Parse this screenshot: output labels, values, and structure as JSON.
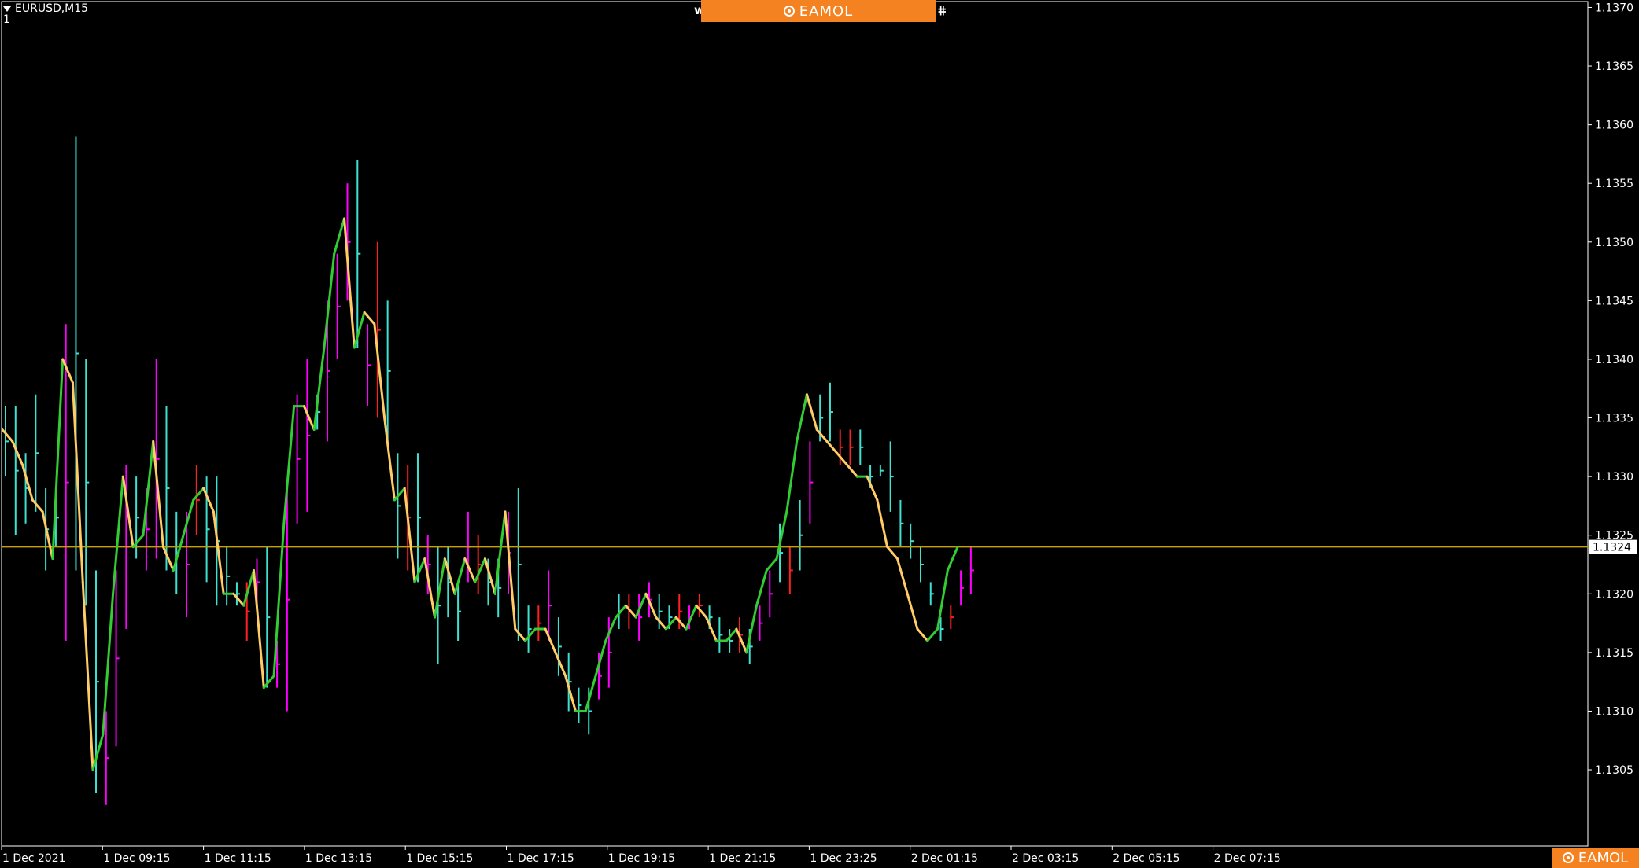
{
  "symbol_label": "EURUSD,M15",
  "subwindow_label": "1",
  "brand": "EAMOL",
  "current_price_label": "1.1324",
  "colors": {
    "background": "#000000",
    "frame": "#ffffff",
    "bar_up": "#40e0d0",
    "bar_down": "#ff00ff",
    "bar_red": "#ff2020",
    "line_up": "#33cc33",
    "line_down": "#ffcc66",
    "price_line": "#c8a000",
    "brand": "#f58220"
  },
  "chart_data": {
    "type": "line",
    "title": "",
    "xlabel": "",
    "ylabel": "",
    "ylim": [
      1.12985,
      1.13705
    ],
    "y_ticks": [
      "1.1305",
      "1.1310",
      "1.1315",
      "1.1320",
      "1.1325",
      "1.1330",
      "1.1335",
      "1.1340",
      "1.1345",
      "1.1350",
      "1.1355",
      "1.1360",
      "1.1365",
      "1.1370"
    ],
    "x_tick_labels": [
      "1 Dec 2021",
      "1 Dec 09:15",
      "1 Dec 11:15",
      "1 Dec 13:15",
      "1 Dec 15:15",
      "1 Dec 17:15",
      "1 Dec 19:15",
      "1 Dec 21:15",
      "1 Dec 23:25",
      "2 Dec 01:15",
      "2 Dec 03:15",
      "2 Dec 05:15",
      "2 Dec 07:15"
    ],
    "current_price": 1.1324,
    "line_values": [
      1.1334,
      1.1333,
      1.1331,
      1.1328,
      1.1327,
      1.1323,
      1.134,
      1.1338,
      1.1321,
      1.1305,
      1.1308,
      1.132,
      1.133,
      1.1324,
      1.1325,
      1.1333,
      1.1324,
      1.1322,
      1.1325,
      1.1328,
      1.1329,
      1.1327,
      1.132,
      1.132,
      1.1319,
      1.1322,
      1.1312,
      1.1313,
      1.1326,
      1.1336,
      1.1336,
      1.1334,
      1.1341,
      1.1349,
      1.1352,
      1.1341,
      1.1344,
      1.1343,
      1.1335,
      1.1328,
      1.1329,
      1.1321,
      1.1323,
      1.1318,
      1.1323,
      1.132,
      1.1323,
      1.1321,
      1.1323,
      1.132,
      1.1327,
      1.1317,
      1.1316,
      1.1317,
      1.1317,
      1.1315,
      1.1313,
      1.131,
      1.131,
      1.1313,
      1.1316,
      1.1318,
      1.1319,
      1.1318,
      1.132,
      1.1318,
      1.1317,
      1.1318,
      1.1317,
      1.1319,
      1.1318,
      1.1316,
      1.1316,
      1.1317,
      1.1315,
      1.1319,
      1.1322,
      1.1323,
      1.1327,
      1.1333,
      1.1337,
      1.1334,
      1.1333,
      1.1332,
      1.1331,
      1.133,
      1.133,
      1.1328,
      1.1324,
      1.1323,
      1.132,
      1.1317,
      1.1316,
      1.1317,
      1.1322,
      1.1324
    ],
    "bars": [
      {
        "h": 1.1336,
        "l": 1.133,
        "c": "u"
      },
      {
        "h": 1.1336,
        "l": 1.1325,
        "c": "u"
      },
      {
        "h": 1.1332,
        "l": 1.1326,
        "c": "u"
      },
      {
        "h": 1.1337,
        "l": 1.1327,
        "c": "u"
      },
      {
        "h": 1.1329,
        "l": 1.1322,
        "c": "u"
      },
      {
        "h": 1.1329,
        "l": 1.1324,
        "c": "u"
      },
      {
        "h": 1.1343,
        "l": 1.1316,
        "c": "d"
      },
      {
        "h": 1.1359,
        "l": 1.1322,
        "c": "u"
      },
      {
        "h": 1.134,
        "l": 1.1319,
        "c": "u"
      },
      {
        "h": 1.1322,
        "l": 1.1303,
        "c": "u"
      },
      {
        "h": 1.131,
        "l": 1.1302,
        "c": "d"
      },
      {
        "h": 1.1322,
        "l": 1.1307,
        "c": "d"
      },
      {
        "h": 1.1331,
        "l": 1.1317,
        "c": "d"
      },
      {
        "h": 1.133,
        "l": 1.1323,
        "c": "u"
      },
      {
        "h": 1.1329,
        "l": 1.1322,
        "c": "d"
      },
      {
        "h": 1.134,
        "l": 1.1323,
        "c": "d"
      },
      {
        "h": 1.1336,
        "l": 1.1322,
        "c": "u"
      },
      {
        "h": 1.1327,
        "l": 1.132,
        "c": "u"
      },
      {
        "h": 1.1327,
        "l": 1.1318,
        "c": "d"
      },
      {
        "h": 1.1331,
        "l": 1.1325,
        "c": "r"
      },
      {
        "h": 1.133,
        "l": 1.1321,
        "c": "u"
      },
      {
        "h": 1.133,
        "l": 1.1319,
        "c": "u"
      },
      {
        "h": 1.1324,
        "l": 1.1319,
        "c": "u"
      },
      {
        "h": 1.1321,
        "l": 1.1319,
        "c": "u"
      },
      {
        "h": 1.1321,
        "l": 1.1316,
        "c": "r"
      },
      {
        "h": 1.1323,
        "l": 1.1319,
        "c": "d"
      },
      {
        "h": 1.1324,
        "l": 1.1312,
        "c": "u"
      },
      {
        "h": 1.1316,
        "l": 1.1312,
        "c": "d"
      },
      {
        "h": 1.1329,
        "l": 1.131,
        "c": "d"
      },
      {
        "h": 1.1337,
        "l": 1.1326,
        "c": "d"
      },
      {
        "h": 1.134,
        "l": 1.1327,
        "c": "d"
      },
      {
        "h": 1.1337,
        "l": 1.1334,
        "c": "u"
      },
      {
        "h": 1.1345,
        "l": 1.1333,
        "c": "d"
      },
      {
        "h": 1.1349,
        "l": 1.134,
        "c": "d"
      },
      {
        "h": 1.1355,
        "l": 1.1345,
        "c": "d"
      },
      {
        "h": 1.1357,
        "l": 1.1341,
        "c": "u"
      },
      {
        "h": 1.1343,
        "l": 1.1336,
        "c": "d"
      },
      {
        "h": 1.135,
        "l": 1.1335,
        "c": "r"
      },
      {
        "h": 1.1345,
        "l": 1.1333,
        "c": "u"
      },
      {
        "h": 1.1332,
        "l": 1.1323,
        "c": "u"
      },
      {
        "h": 1.1331,
        "l": 1.1322,
        "c": "r"
      },
      {
        "h": 1.1332,
        "l": 1.1321,
        "c": "u"
      },
      {
        "h": 1.1325,
        "l": 1.132,
        "c": "d"
      },
      {
        "h": 1.1324,
        "l": 1.1314,
        "c": "u"
      },
      {
        "h": 1.1324,
        "l": 1.1318,
        "c": "u"
      },
      {
        "h": 1.1321,
        "l": 1.1316,
        "c": "u"
      },
      {
        "h": 1.1327,
        "l": 1.1321,
        "c": "d"
      },
      {
        "h": 1.1325,
        "l": 1.132,
        "c": "r"
      },
      {
        "h": 1.1323,
        "l": 1.1319,
        "c": "u"
      },
      {
        "h": 1.1323,
        "l": 1.1318,
        "c": "u"
      },
      {
        "h": 1.1327,
        "l": 1.132,
        "c": "d"
      },
      {
        "h": 1.1329,
        "l": 1.1316,
        "c": "u"
      },
      {
        "h": 1.1319,
        "l": 1.1315,
        "c": "u"
      },
      {
        "h": 1.1319,
        "l": 1.1316,
        "c": "r"
      },
      {
        "h": 1.1322,
        "l": 1.1316,
        "c": "d"
      },
      {
        "h": 1.1318,
        "l": 1.1313,
        "c": "u"
      },
      {
        "h": 1.1315,
        "l": 1.131,
        "c": "u"
      },
      {
        "h": 1.1312,
        "l": 1.1309,
        "c": "u"
      },
      {
        "h": 1.1312,
        "l": 1.1308,
        "c": "u"
      },
      {
        "h": 1.1315,
        "l": 1.1311,
        "c": "d"
      },
      {
        "h": 1.1318,
        "l": 1.1312,
        "c": "d"
      },
      {
        "h": 1.132,
        "l": 1.1317,
        "c": "u"
      },
      {
        "h": 1.132,
        "l": 1.1317,
        "c": "r"
      },
      {
        "h": 1.132,
        "l": 1.1316,
        "c": "d"
      },
      {
        "h": 1.1321,
        "l": 1.1318,
        "c": "d"
      },
      {
        "h": 1.132,
        "l": 1.1317,
        "c": "u"
      },
      {
        "h": 1.1319,
        "l": 1.1317,
        "c": "u"
      },
      {
        "h": 1.132,
        "l": 1.1317,
        "c": "r"
      },
      {
        "h": 1.1319,
        "l": 1.1317,
        "c": "d"
      },
      {
        "h": 1.132,
        "l": 1.1318,
        "c": "r"
      },
      {
        "h": 1.1319,
        "l": 1.1317,
        "c": "u"
      },
      {
        "h": 1.1318,
        "l": 1.1315,
        "c": "u"
      },
      {
        "h": 1.1317,
        "l": 1.1315,
        "c": "u"
      },
      {
        "h": 1.1318,
        "l": 1.1315,
        "c": "r"
      },
      {
        "h": 1.1317,
        "l": 1.1314,
        "c": "u"
      },
      {
        "h": 1.1319,
        "l": 1.1316,
        "c": "d"
      },
      {
        "h": 1.1322,
        "l": 1.1318,
        "c": "d"
      },
      {
        "h": 1.1326,
        "l": 1.1321,
        "c": "u"
      },
      {
        "h": 1.1324,
        "l": 1.132,
        "c": "r"
      },
      {
        "h": 1.1328,
        "l": 1.1322,
        "c": "u"
      },
      {
        "h": 1.1333,
        "l": 1.1326,
        "c": "d"
      },
      {
        "h": 1.1337,
        "l": 1.1333,
        "c": "u"
      },
      {
        "h": 1.1338,
        "l": 1.1333,
        "c": "u"
      },
      {
        "h": 1.1334,
        "l": 1.1331,
        "c": "r"
      },
      {
        "h": 1.1334,
        "l": 1.1331,
        "c": "r"
      },
      {
        "h": 1.1334,
        "l": 1.1331,
        "c": "u"
      },
      {
        "h": 1.1331,
        "l": 1.1329,
        "c": "u"
      },
      {
        "h": 1.1331,
        "l": 1.133,
        "c": "u"
      },
      {
        "h": 1.1333,
        "l": 1.1327,
        "c": "u"
      },
      {
        "h": 1.1328,
        "l": 1.1324,
        "c": "u"
      },
      {
        "h": 1.1326,
        "l": 1.1323,
        "c": "u"
      },
      {
        "h": 1.1324,
        "l": 1.1321,
        "c": "u"
      },
      {
        "h": 1.1321,
        "l": 1.1319,
        "c": "u"
      },
      {
        "h": 1.1318,
        "l": 1.1316,
        "c": "u"
      },
      {
        "h": 1.1319,
        "l": 1.1317,
        "c": "r"
      },
      {
        "h": 1.1322,
        "l": 1.1319,
        "c": "d"
      },
      {
        "h": 1.1324,
        "l": 1.132,
        "c": "d"
      }
    ]
  }
}
